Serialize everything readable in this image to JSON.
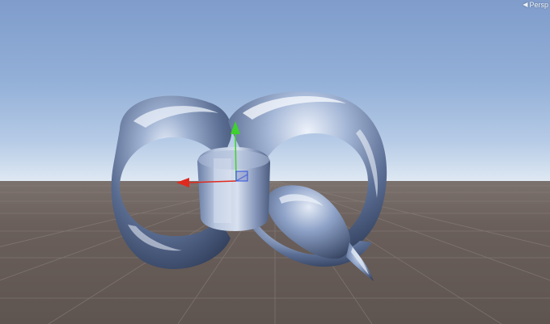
{
  "scene_view": {
    "projection_label": "Persp",
    "projection_icon": "chevron-left-icon",
    "sky_colors": [
      "#7f9ccb",
      "#dfe9f3"
    ],
    "ground_color": "#6a5f5b",
    "grid_color": "#8a807c"
  },
  "gizmo": {
    "x_axis_color": "#e02a1e",
    "y_axis_color": "#3fd12e",
    "z_axis_color": "#2f4fe0",
    "center_handle_color": "#8a97c8"
  },
  "model": {
    "material": "chrome",
    "highlight_color": "#eef3fb",
    "shadow_color": "#3b4a66"
  }
}
